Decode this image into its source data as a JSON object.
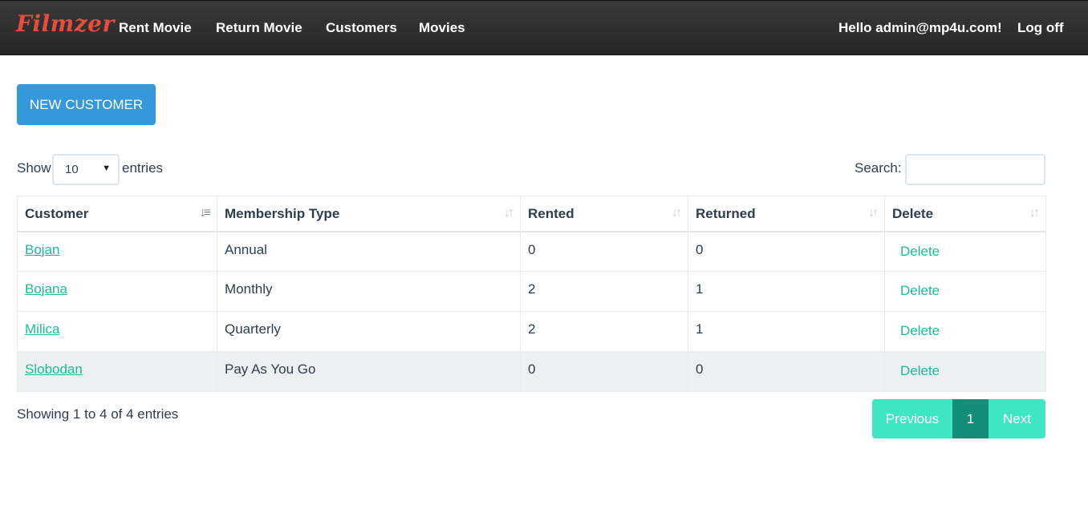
{
  "navbar": {
    "brand": "Filmzer",
    "links": [
      "Rent Movie",
      "Return Movie",
      "Customers",
      "Movies"
    ],
    "greeting": "Hello admin@mp4u.com!",
    "logoff": "Log off"
  },
  "actions": {
    "new_customer": "New Customer"
  },
  "length": {
    "show": "Show",
    "value": "10",
    "entries": "entries"
  },
  "search": {
    "label": "Search:",
    "value": "",
    "placeholder": ""
  },
  "table": {
    "columns": [
      "Customer",
      "Membership Type",
      "Rented",
      "Returned",
      "Delete"
    ],
    "rows": [
      {
        "customer": "Bojan",
        "membership": "Annual",
        "rented": "0",
        "returned": "0",
        "delete": "Delete"
      },
      {
        "customer": "Bojana",
        "membership": "Monthly",
        "rented": "2",
        "returned": "1",
        "delete": "Delete"
      },
      {
        "customer": "Milica",
        "membership": "Quarterly",
        "rented": "2",
        "returned": "1",
        "delete": "Delete"
      },
      {
        "customer": "Slobodan",
        "membership": "Pay As You Go",
        "rented": "0",
        "returned": "0",
        "delete": "Delete"
      }
    ]
  },
  "info": "Showing 1 to 4 of 4 entries",
  "pagination": {
    "previous": "Previous",
    "page": "1",
    "next": "Next"
  },
  "colors": {
    "navbar": "#2c2c2c",
    "brand": "#e74c3c",
    "primary": "#3498db",
    "link": "#18bc9c",
    "pager": "#3ee6c4",
    "pager_active": "#128f76"
  }
}
